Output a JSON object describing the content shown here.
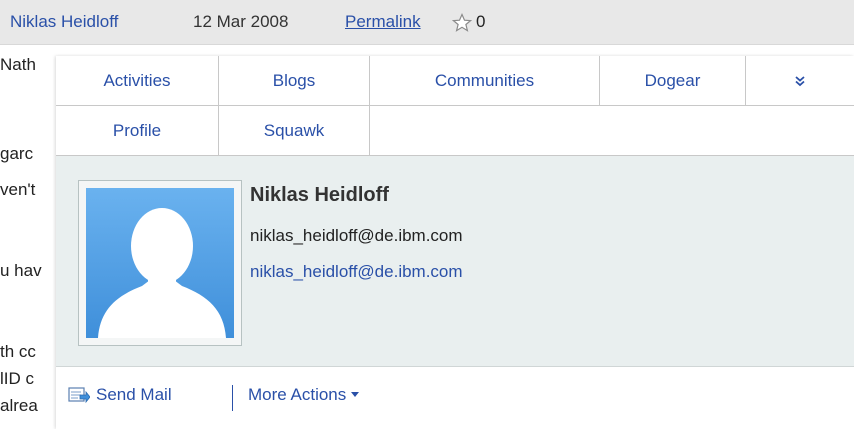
{
  "header": {
    "author": "Niklas Heidloff",
    "date": "12 Mar 2008",
    "permalink": "Permalink",
    "count": "0"
  },
  "background_text": [
    "Nath",
    "garc",
    "ven't",
    "u hav",
    "th cc",
    "lID c",
    "alrea"
  ],
  "tabs": {
    "activities": "Activities",
    "blogs": "Blogs",
    "communities": "Communities",
    "dogear": "Dogear",
    "more": "»",
    "profile": "Profile",
    "squawk": "Squawk"
  },
  "person": {
    "name": "Niklas Heidloff",
    "email": "niklas_heidloff@de.ibm.com",
    "email_link": "niklas_heidloff@de.ibm.com"
  },
  "actions": {
    "send_mail": "Send Mail",
    "more_actions": "More Actions"
  },
  "colors": {
    "link": "#2a50a8",
    "header_bg": "#e8e8e8",
    "profile_bg": "#e9efef",
    "photo_bg": "#5aa3e6"
  }
}
